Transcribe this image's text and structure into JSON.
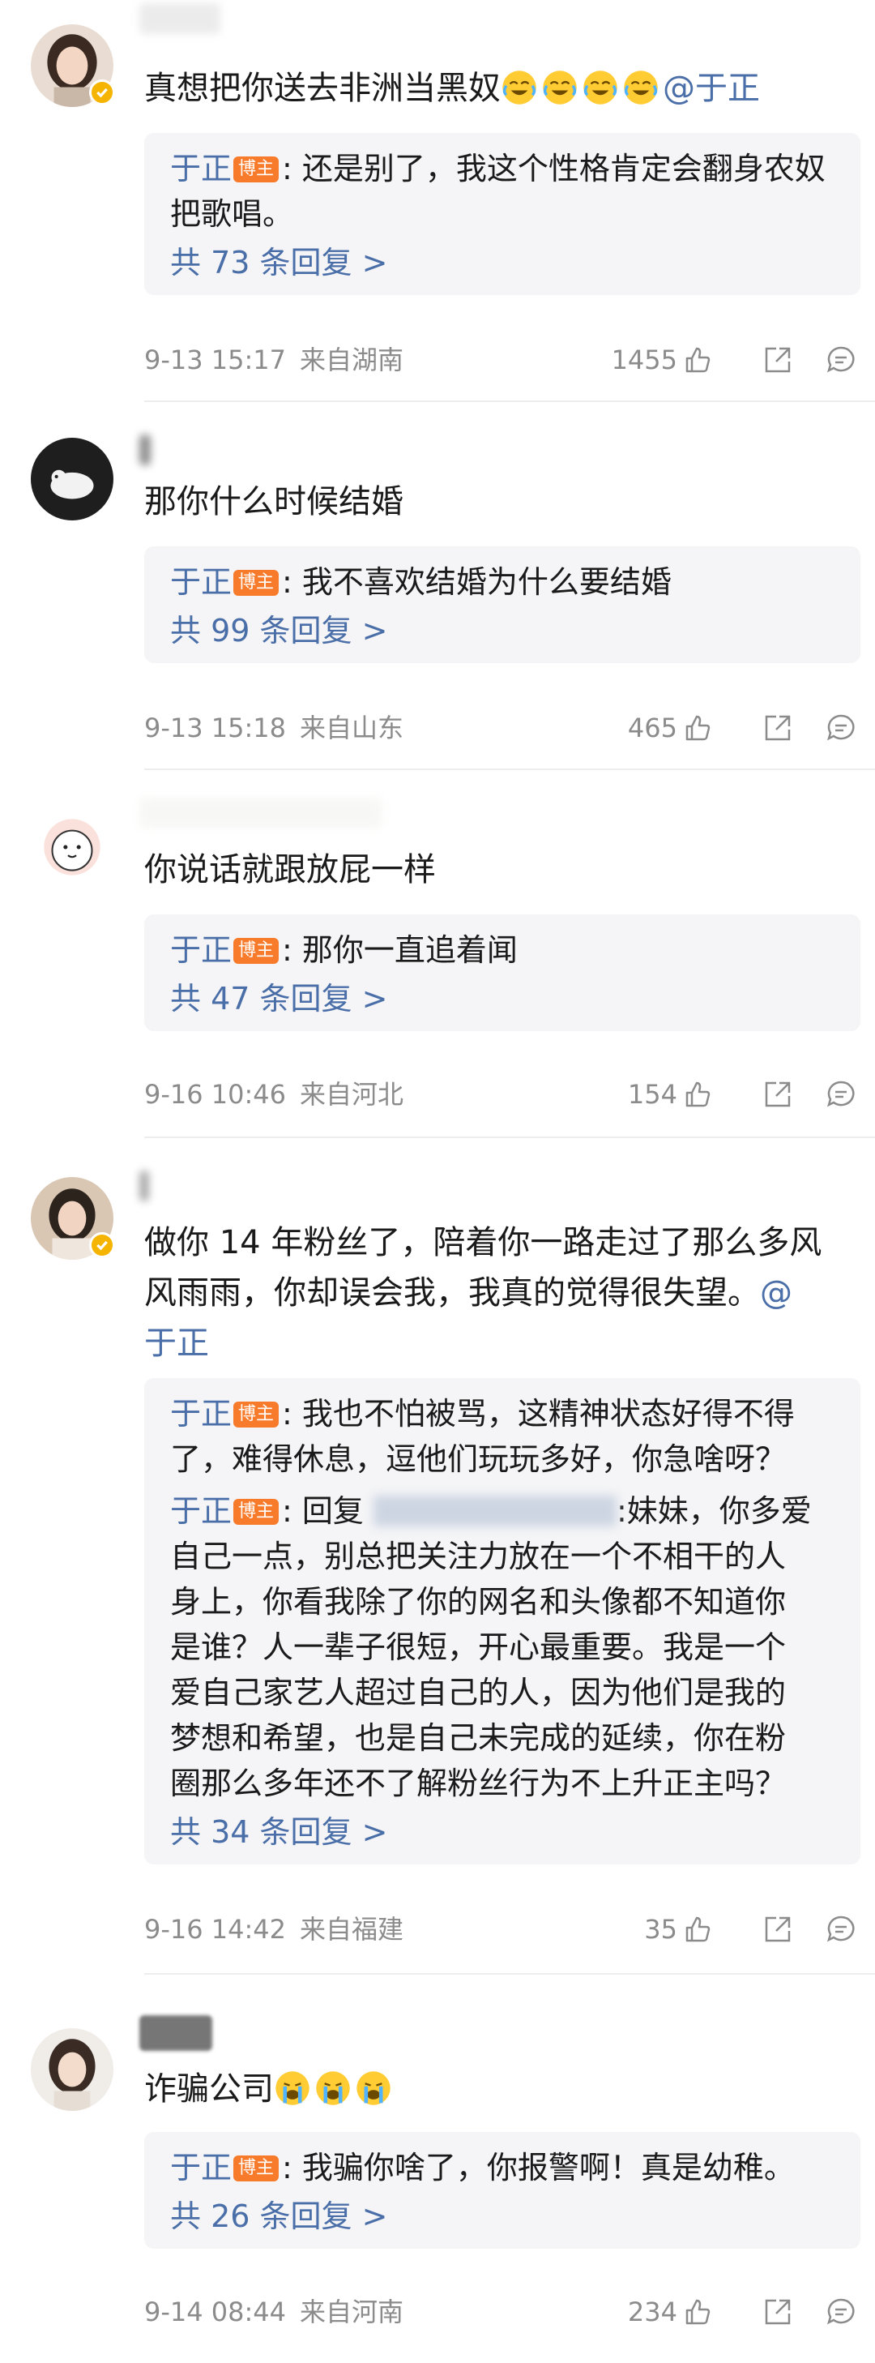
{
  "comments": [
    {
      "text": "真想把你送去非洲当黑奴",
      "mention": "@于正",
      "emoji_icons": [
        "tears-of-joy-emoji",
        "tears-of-joy-emoji",
        "tears-of-joy-emoji",
        "tears-of-joy-emoji"
      ],
      "verified": true,
      "replies": [
        {
          "name": "于正",
          "badge": "博主",
          "text": ": 还是别了，我这个性格肯定会翻身农奴把歌唱。"
        }
      ],
      "reply_count": "共 73 条回复 >",
      "time": "9-13 15:17",
      "location": "来自湖南",
      "likes": "1455"
    },
    {
      "text": "那你什么时候结婚",
      "verified": false,
      "replies": [
        {
          "name": "于正",
          "badge": "博主",
          "text": ": 我不喜欢结婚为什么要结婚"
        }
      ],
      "reply_count": "共 99 条回复 >",
      "time": "9-13 15:18",
      "location": "来自山东",
      "likes": "465"
    },
    {
      "text": "你说话就跟放屁一样",
      "verified": false,
      "replies": [
        {
          "name": "于正",
          "badge": "博主",
          "text": ": 那你一直追着闻"
        }
      ],
      "reply_count": "共 47 条回复 >",
      "time": "9-16 10:46",
      "location": "来自河北",
      "likes": "154"
    },
    {
      "text_line1": "做你 14 年粉丝了，陪着你一路走过了那么多风",
      "text_line2": "风雨雨，你却误会我，我真的觉得很失望。",
      "mention_end": "@",
      "text_line3": "于正",
      "verified": true,
      "replies": [
        {
          "name": "于正",
          "badge": "博主",
          "line1": ": 我也不怕被骂，这精神状态好得不得",
          "line2": "了，难得休息，逗他们玩玩多好，你急啥呀？"
        },
        {
          "name": "于正",
          "badge": "博主",
          "prefix": ": 回复 ",
          "after_blur": ":妹妹，你多爱",
          "lines": [
            "自己一点，别总把关注力放在一个不相干的人",
            "身上，你看我除了你的网名和头像都不知道你",
            "是谁？人一辈子很短，开心最重要。我是一个",
            "爱自己家艺人超过自己的人，因为他们是我的",
            "梦想和希望，也是自己未完成的延续，你在粉",
            "圈那么多年还不了解粉丝行为不上升正主吗？"
          ]
        }
      ],
      "reply_count": "共 34 条回复 >",
      "time": "9-16 14:42",
      "location": "来自福建",
      "likes": "35"
    },
    {
      "text": "诈骗公司",
      "emoji_icons": [
        "crying-emoji",
        "crying-emoji",
        "crying-emoji"
      ],
      "verified": false,
      "replies": [
        {
          "name": "于正",
          "badge": "博主",
          "text": ": 我骗你啥了，你报警啊！真是幼稚。"
        }
      ],
      "reply_count": "共 26 条回复 >",
      "time": "9-14 08:44",
      "location": "来自河南",
      "likes": "234"
    }
  ],
  "colors": {
    "link": "#4a6ea8",
    "badge": "#f77b2b",
    "reply_bg": "#f5f5f7",
    "meta_text": "#8b8b8b"
  }
}
